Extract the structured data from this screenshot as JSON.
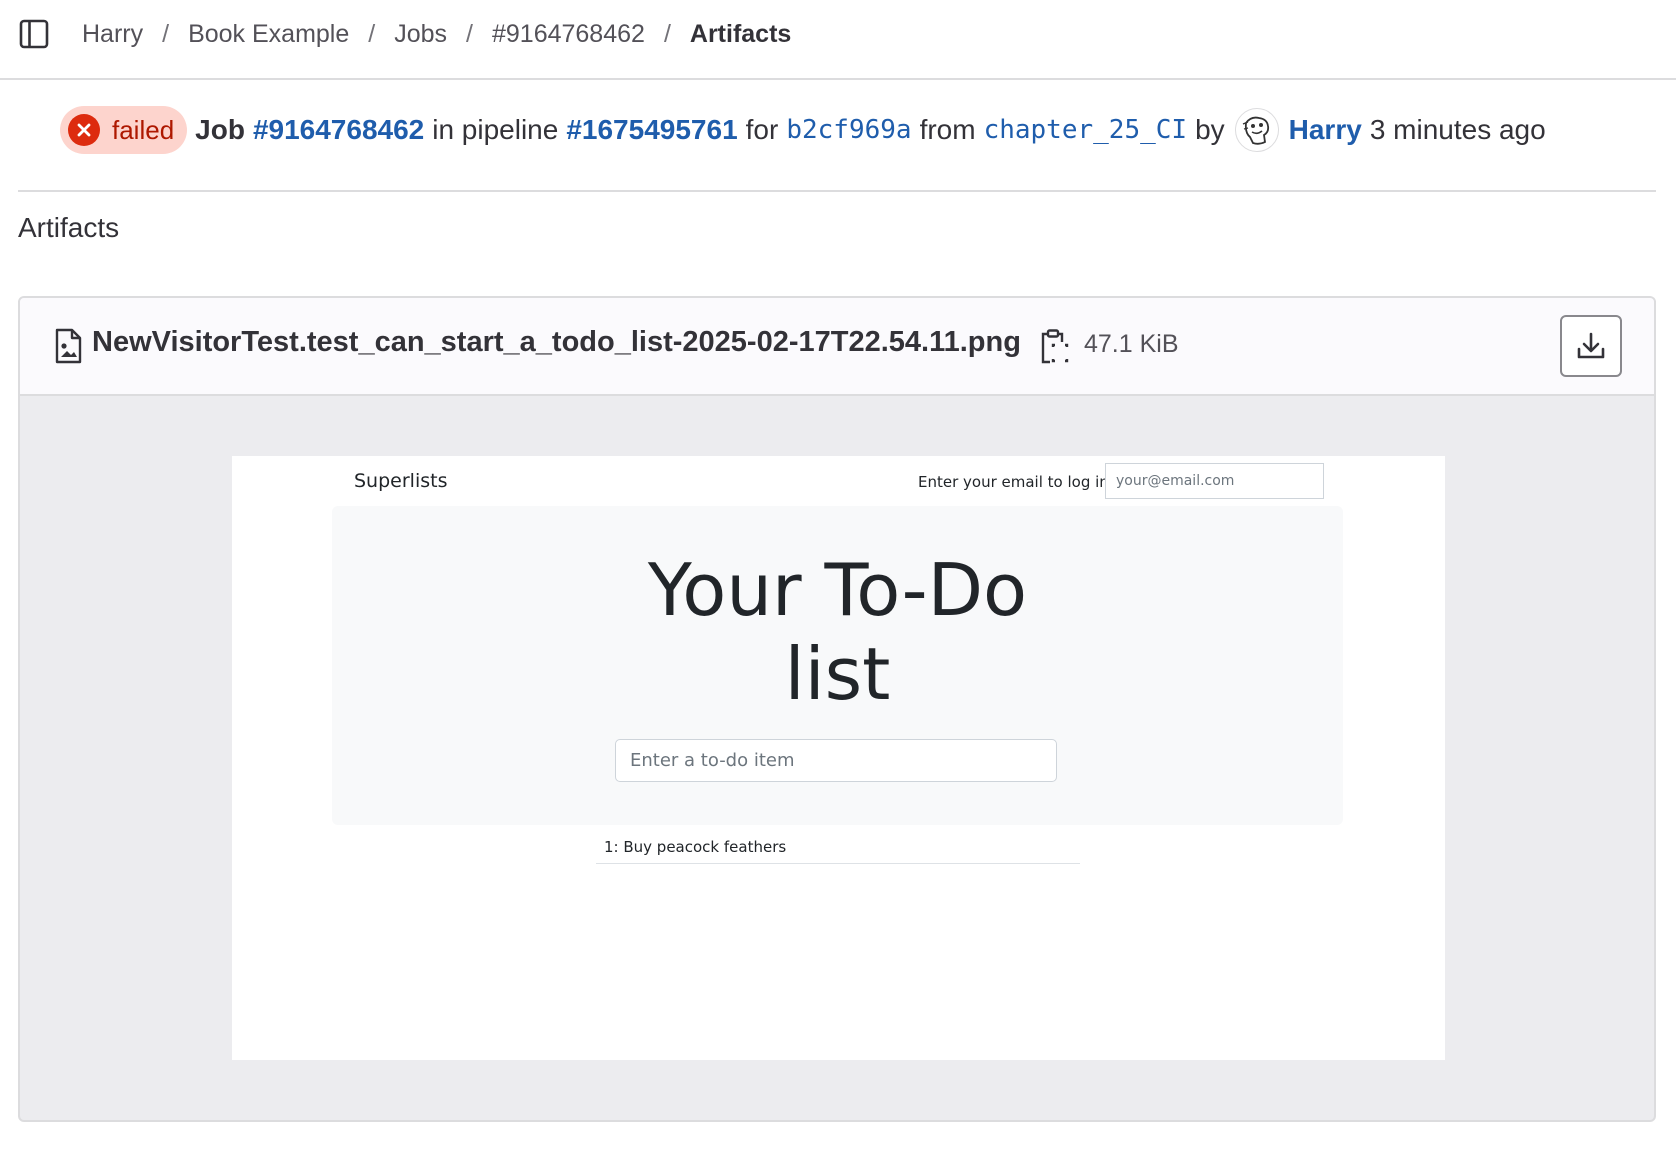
{
  "breadcrumb": {
    "items": [
      "Harry",
      "Book Example",
      "Jobs",
      "#9164768462"
    ],
    "current": "Artifacts",
    "separator": "/"
  },
  "job": {
    "status": "failed",
    "job_word": "Job",
    "job_id": "#9164768462",
    "in_pipeline": "in pipeline",
    "pipeline_id": "#1675495761",
    "for_word": "for",
    "commit": "b2cf969a",
    "from_word": "from",
    "branch": "chapter_25_CI",
    "by_word": "by",
    "user": "Harry",
    "time_ago": "3 minutes ago"
  },
  "section": {
    "title": "Artifacts"
  },
  "file": {
    "name": "NewVisitorTest.test_can_start_a_todo_list-2025-02-17T22.54.11.png",
    "size": "47.1 KiB"
  },
  "preview": {
    "brand": "Superlists",
    "login_label": "Enter your email to log in",
    "email_placeholder": "your@email.com",
    "heading_line1": "Your To-Do",
    "heading_line2": "list",
    "item_placeholder": "Enter a to-do item",
    "rows": [
      "1: Buy peacock feathers"
    ]
  },
  "colors": {
    "link": "#1f5dac",
    "failed_bg": "#fdd4cd",
    "failed_text": "#ae1800",
    "failed_icon": "#dd2b0e"
  }
}
